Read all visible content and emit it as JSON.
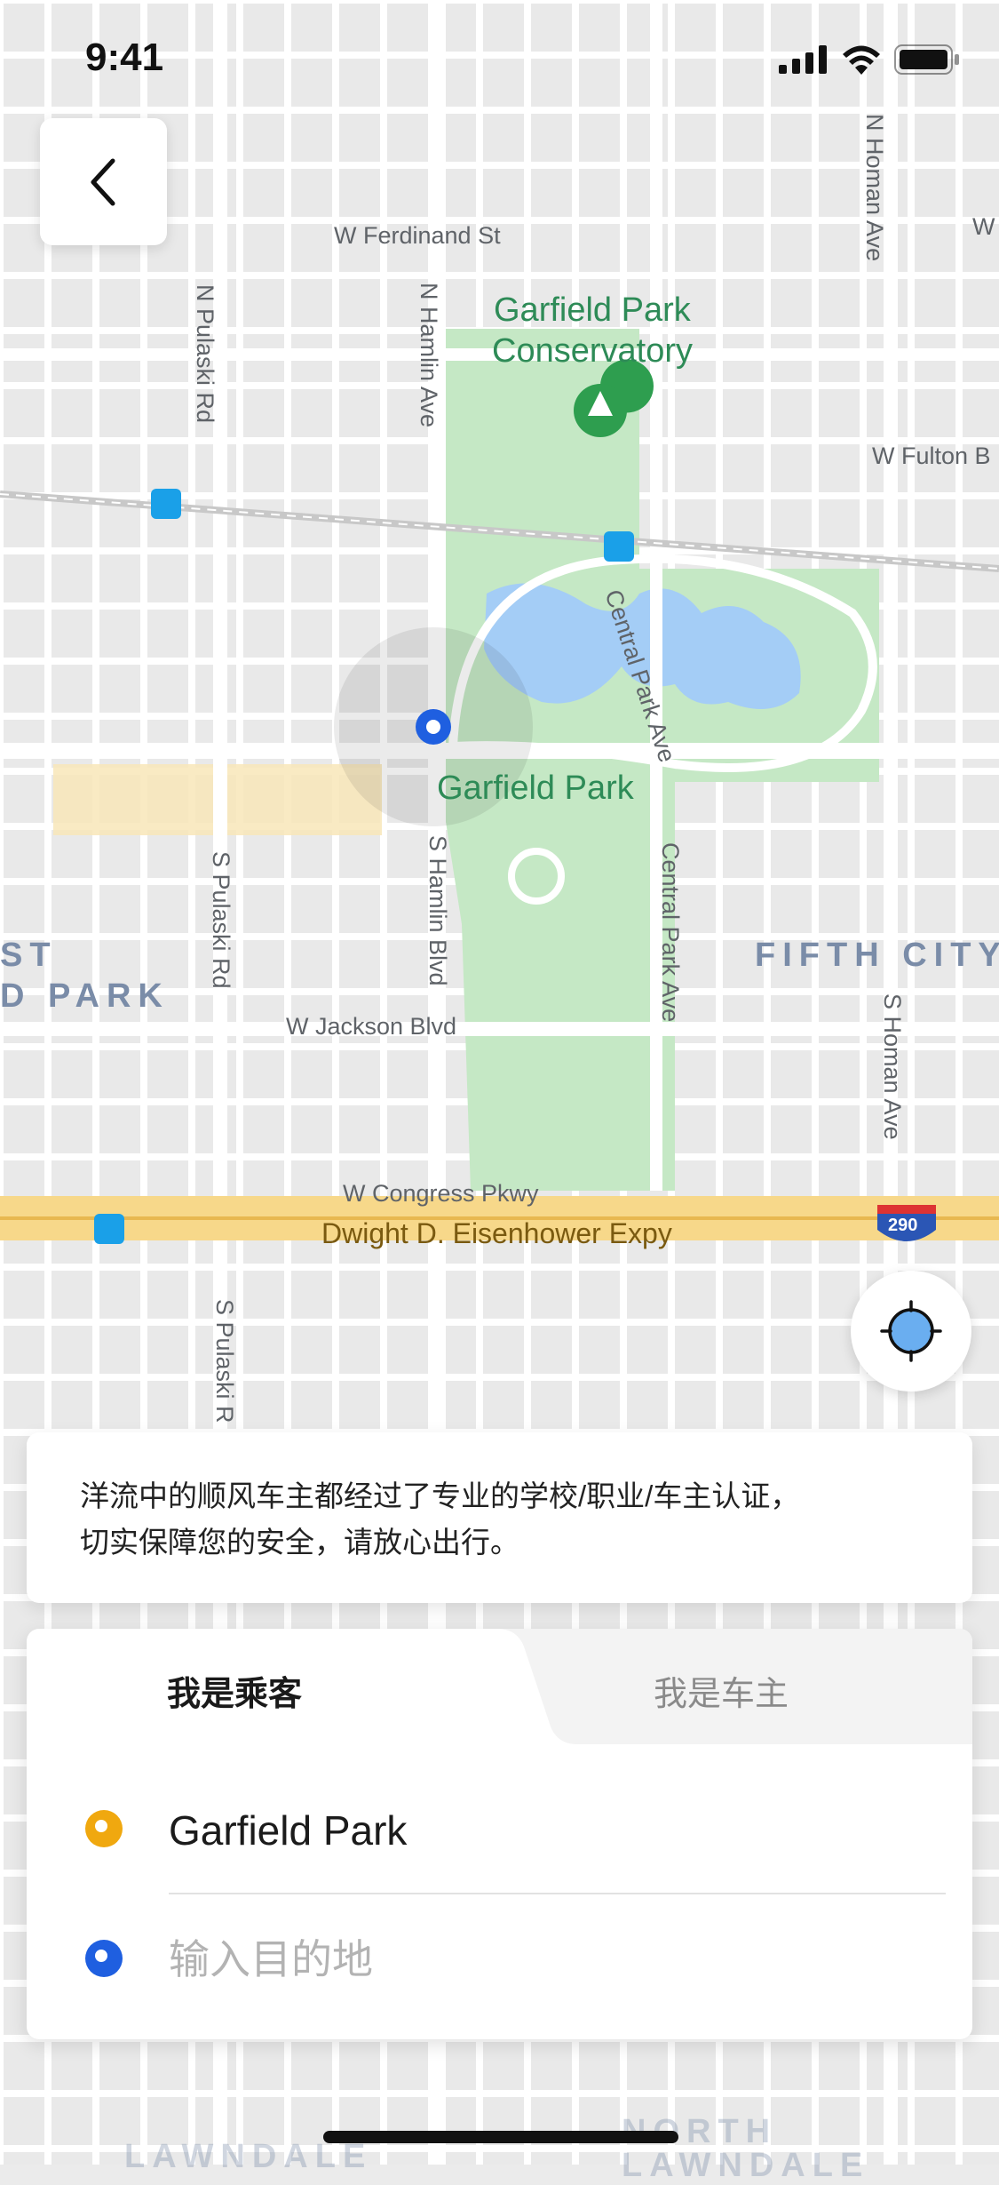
{
  "status_bar": {
    "time": "9:41",
    "icons": [
      "signal-icon",
      "wifi-icon",
      "battery-icon"
    ]
  },
  "map": {
    "streets": [
      "W Ferdinand St",
      "W",
      "N Homan Ave",
      "N Pulaski Rd",
      "N Hamlin Ave",
      "W Fulton B",
      "Central Park Ave",
      "S Pulaski Rd",
      "S Hamlin Blvd",
      "Central Park Ave",
      "W Jackson Blvd",
      "S Homan Ave",
      "W Congress Pkwy",
      "Dwight D. Eisenhower Expy",
      "S Pulaski R"
    ],
    "places": [
      "Garfield Park",
      "Conservatory",
      "Garfield Park"
    ],
    "districts": [
      "ST",
      "D PARK",
      "FIFTH CITY",
      "NORTH",
      "LAWNDALE",
      "LAWNDALE"
    ],
    "highway_shield": "290",
    "colors": {
      "park": "#c5e8c5",
      "water": "#a4cdf6",
      "road": "#ffffff",
      "expressway": "#f7d88a",
      "metro": "#1aa0e8"
    }
  },
  "buttons": {
    "back_icon": "chevron-left-icon",
    "locate_icon": "crosshair-icon"
  },
  "notice": {
    "line1": "洋流中的顺风车主都经过了专业的学校/职业/车主认证，",
    "line2": "切实保障您的安全，请放心出行。"
  },
  "booking": {
    "tabs": [
      {
        "label": "我是乘客",
        "active": true
      },
      {
        "label": "我是车主",
        "active": false
      }
    ],
    "origin": "Garfield Park",
    "destination_placeholder": "输入目的地",
    "colors": {
      "origin_dot": "#f0a80f",
      "dest_dot": "#1f5fe0"
    }
  }
}
